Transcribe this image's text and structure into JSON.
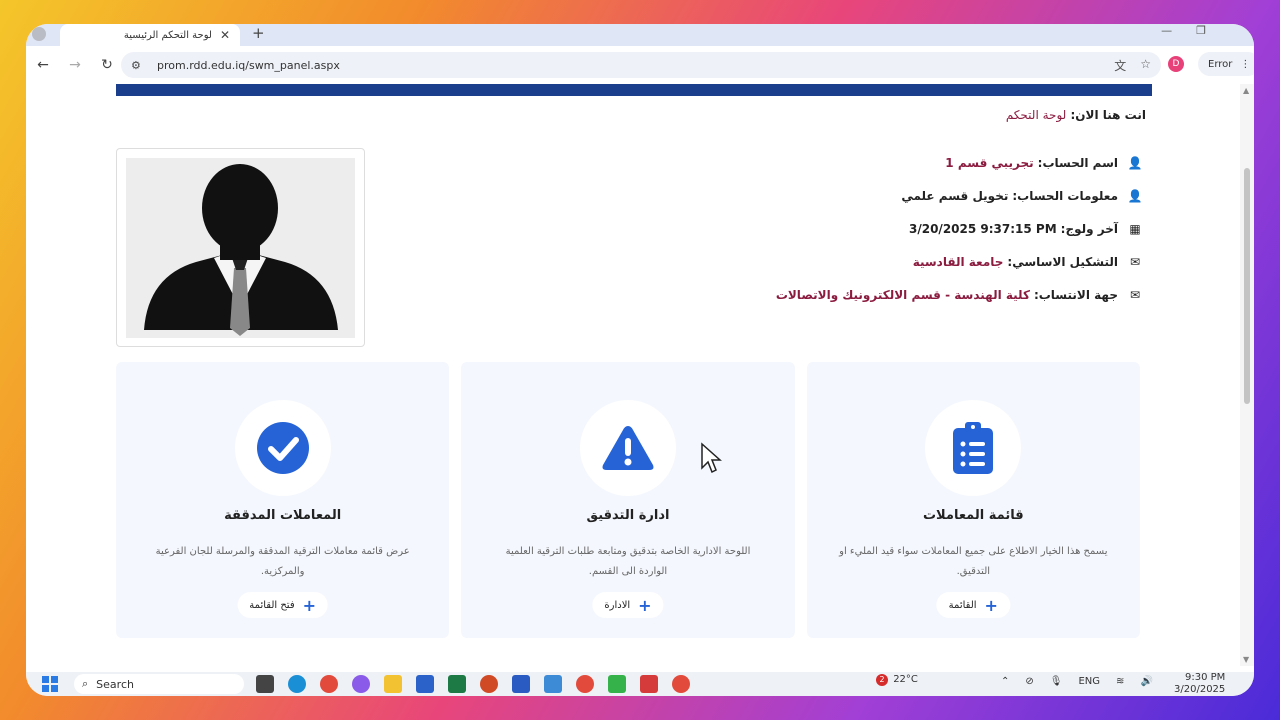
{
  "browser": {
    "tab_title": "لوحة التحكم الرئيسية",
    "tab_close": "✕",
    "new_tab": "+",
    "url": "prom.rdd.edu.iq/swm_panel.aspx",
    "profile_initial": "D",
    "error_label": "Error",
    "menu_glyph": "⋮"
  },
  "page": {
    "breadcrumb_prefix": "انت هنا الان:",
    "breadcrumb_link": "لوحة التحكم",
    "info": [
      {
        "label": "اسم الحساب:",
        "value": "تجريبي قسم 1",
        "icon": "user-icon",
        "style": "red"
      },
      {
        "label": "معلومات الحساب:",
        "value": "تخويل قسم علمي",
        "icon": "user-icon",
        "style": "dark"
      },
      {
        "label": "آخر ولوج:",
        "value": "3/20/2025 9:37:15 PM",
        "icon": "calendar-icon",
        "style": "dark"
      },
      {
        "label": "التشكيل الاساسي:",
        "value": "جامعة القادسية",
        "icon": "envelope-open-icon",
        "style": "red"
      },
      {
        "label": "جهة الانتساب:",
        "value": "كلية الهندسة - قسم الالكترونيك والاتصالات",
        "icon": "envelope-open-icon",
        "style": "red"
      }
    ],
    "cards": [
      {
        "title": "المعاملات المدققة",
        "desc": "عرض قائمة معاملات الترقية المدققة والمرسلة للجان الفرعية والمركزية.",
        "button": "فتح القائمة",
        "icon": "check-circle-icon"
      },
      {
        "title": "ادارة التدقيق",
        "desc": "اللوحة الادارية الخاصة بتدقيق ومتابعة طلبات الترقية العلمية الواردة الى القسم.",
        "button": "الادارة",
        "icon": "warning-triangle-icon"
      },
      {
        "title": "قائمة المعاملات",
        "desc": "يسمح هذا الخيار الاطلاع على جميع المعاملات سواء قيد المليء او التدقيق.",
        "button": "القائمة",
        "icon": "clipboard-list-icon"
      }
    ]
  },
  "taskbar": {
    "search_label": "Search",
    "weather_temp": "22°C",
    "weather_badge": "2",
    "lang": "ENG",
    "time": "9:30 PM",
    "date": "3/20/2025"
  },
  "colors": {
    "accent_blue": "#2563d6",
    "header_band": "#1a3d8c",
    "value_red": "#8b1c40"
  }
}
